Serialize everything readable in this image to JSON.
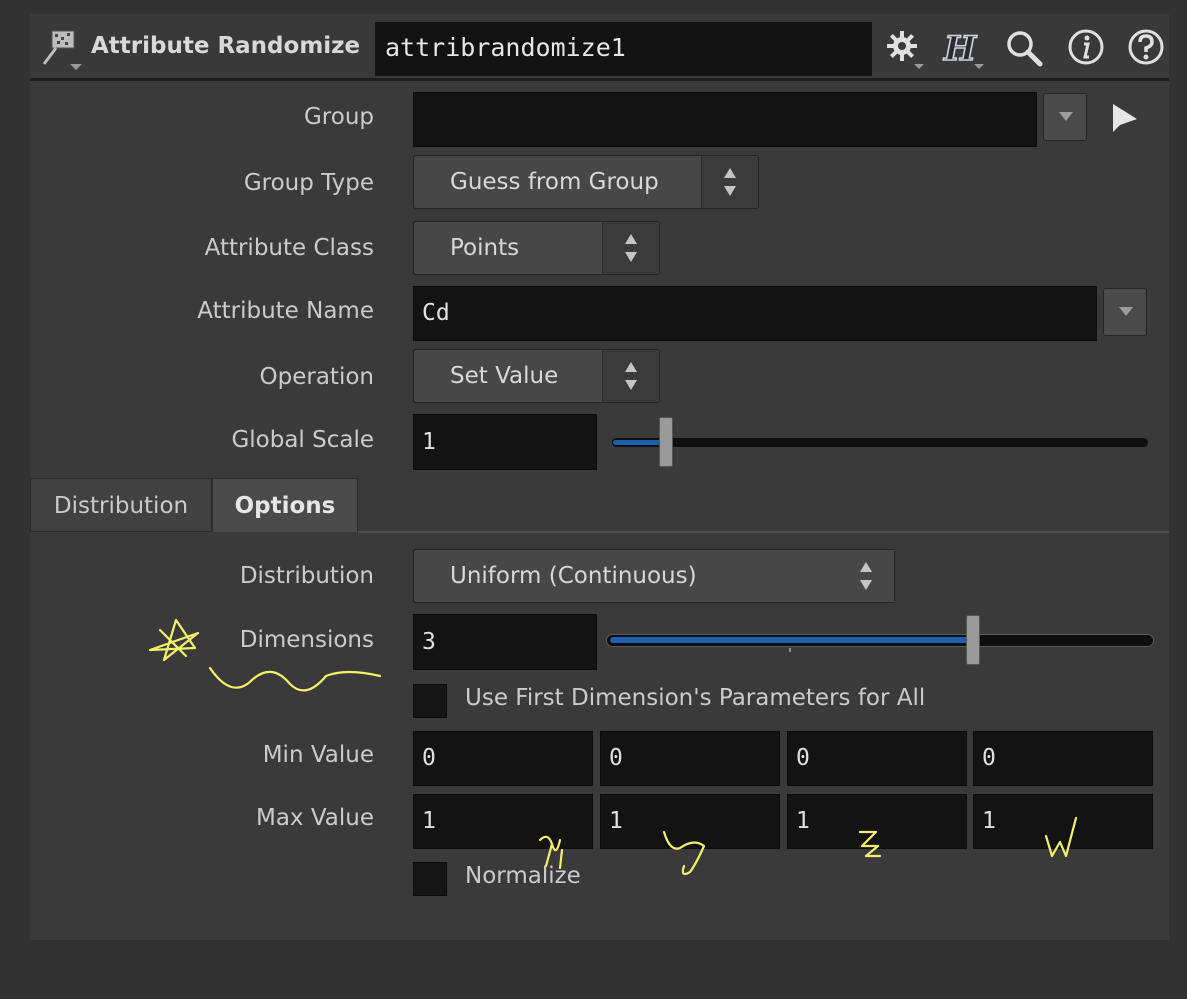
{
  "header": {
    "node_type": "Attribute Randomize",
    "node_name": "attribrandomize1",
    "icons": [
      "node-type-icon",
      "gear-icon",
      "houdini-help-icon",
      "search-icon",
      "info-icon",
      "help-icon"
    ]
  },
  "params": {
    "group": {
      "label": "Group",
      "value": ""
    },
    "group_type": {
      "label": "Group Type",
      "value": "Guess from Group"
    },
    "attribute_class": {
      "label": "Attribute Class",
      "value": "Points"
    },
    "attribute_name": {
      "label": "Attribute Name",
      "value": "Cd"
    },
    "operation": {
      "label": "Operation",
      "value": "Set Value"
    },
    "global_scale": {
      "label": "Global Scale",
      "value": "1",
      "slider_fraction": 0.1
    }
  },
  "tabs": [
    {
      "label": "Distribution",
      "active": false
    },
    {
      "label": "Options",
      "active": true
    }
  ],
  "options": {
    "distribution": {
      "label": "Distribution",
      "value": "Uniform (Continuous)"
    },
    "dimensions": {
      "label": "Dimensions",
      "value": "3",
      "slider_fraction": 0.67
    },
    "use_first": {
      "label": "Use First Dimension's Parameters for All",
      "checked": false
    },
    "min_value": {
      "label": "Min Value",
      "values": [
        "0",
        "0",
        "0",
        "0"
      ]
    },
    "max_value": {
      "label": "Max Value",
      "values": [
        "1",
        "1",
        "1",
        "1"
      ]
    },
    "normalize": {
      "label": "Normalize",
      "checked": false
    }
  },
  "colors": {
    "slider_fill": "#1f5fb0",
    "annotation": "#f5f06a"
  }
}
